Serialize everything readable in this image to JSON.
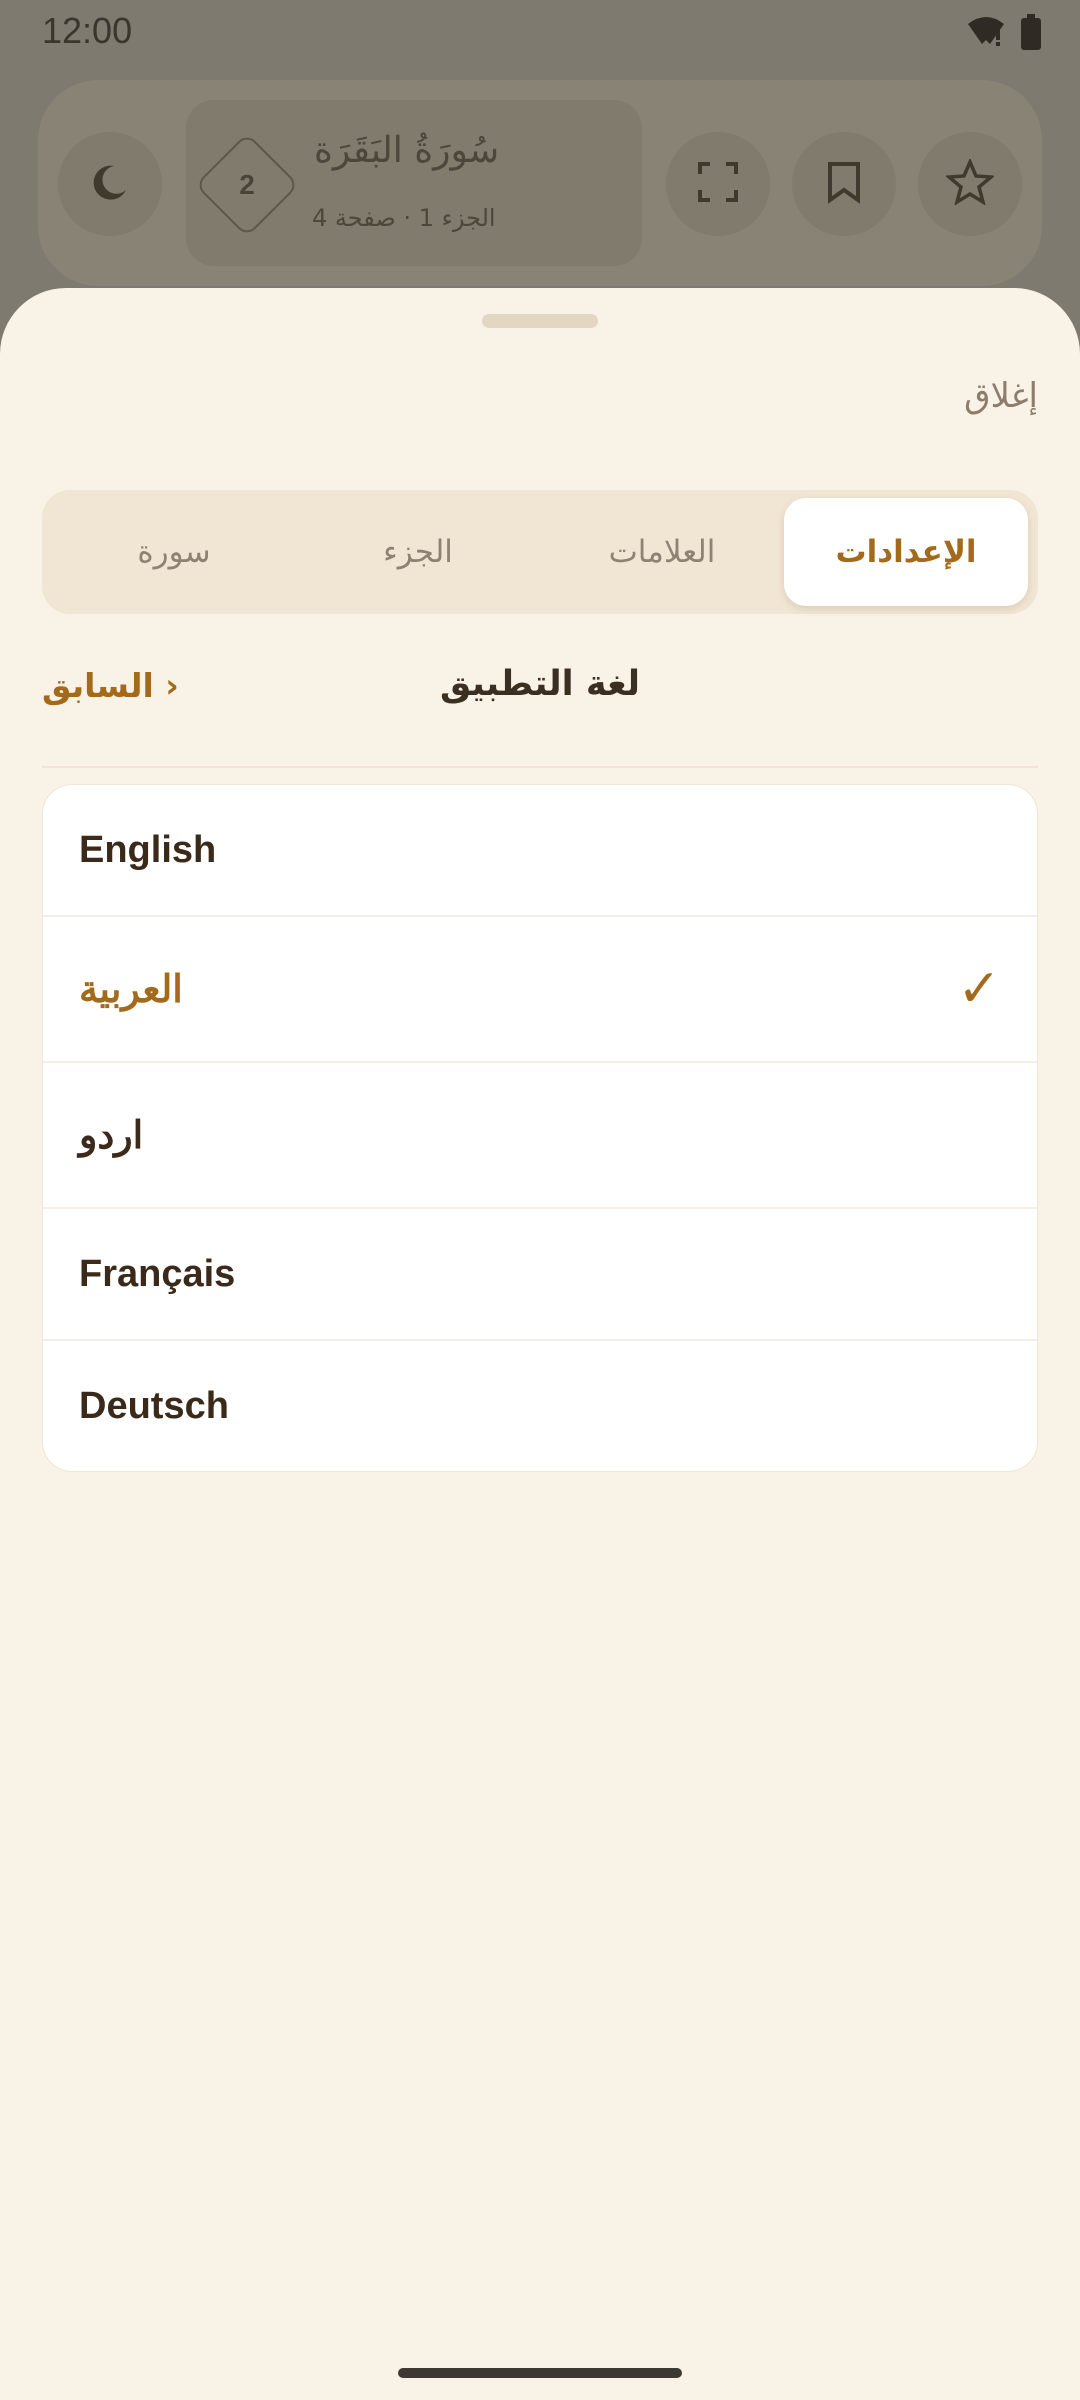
{
  "status_bar": {
    "time": "12:00",
    "icons": [
      "wifi-icon",
      "battery-icon"
    ]
  },
  "top_bar": {
    "page_number": "2",
    "surah_name": "سُورَةُ البَقَرَة",
    "subtitle": "الجزء 1 · صفحة 4",
    "buttons": [
      "moon-icon",
      "fullscreen-icon",
      "bookmark-icon",
      "star-icon"
    ]
  },
  "sheet": {
    "close_label": "إغلاق",
    "tabs": [
      {
        "label": "الإعدادات",
        "active": true
      },
      {
        "label": "العلامات",
        "active": false
      },
      {
        "label": "الجزء",
        "active": false
      },
      {
        "label": "سورة",
        "active": false
      }
    ],
    "section": {
      "title": "لغة التطبيق",
      "back_label": "السابق ›"
    },
    "languages": [
      {
        "label": "English",
        "selected": false
      },
      {
        "label": "العربية",
        "selected": true
      },
      {
        "label": "اردو",
        "selected": false
      },
      {
        "label": "Français",
        "selected": false
      },
      {
        "label": "Deutsch",
        "selected": false
      }
    ],
    "check_glyph": "✓"
  },
  "colors": {
    "accent": "#a46a1c",
    "sheet_background": "#f9f2e6",
    "scrim": "#7e7a70"
  }
}
